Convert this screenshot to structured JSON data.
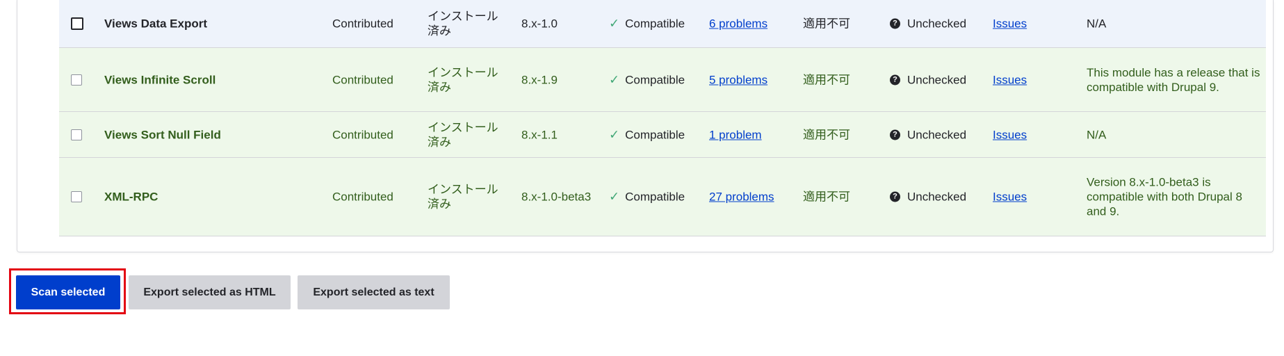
{
  "table": {
    "rows": [
      {
        "name": "Views Data Export",
        "type": "Contributed",
        "status": "インストール済み",
        "version": "8.x-1.0",
        "compatibility": "Compatible",
        "problems": "6 problems",
        "na": "適用不可",
        "unchecked": "Unchecked",
        "issues": "Issues",
        "notes": "N/A",
        "checked": true
      },
      {
        "name": "Views Infinite Scroll",
        "type": "Contributed",
        "status": "インストール済み",
        "version": "8.x-1.9",
        "compatibility": "Compatible",
        "problems": "5 problems",
        "na": "適用不可",
        "unchecked": "Unchecked",
        "issues": "Issues",
        "notes": "This module has a release that is compatible with Drupal 9.",
        "checked": false
      },
      {
        "name": "Views Sort Null Field",
        "type": "Contributed",
        "status": "インストール済み",
        "version": "8.x-1.1",
        "compatibility": "Compatible",
        "problems": "1 problem",
        "na": "適用不可",
        "unchecked": "Unchecked",
        "issues": "Issues",
        "notes": "N/A",
        "checked": false
      },
      {
        "name": "XML-RPC",
        "type": "Contributed",
        "status": "インストール済み",
        "version": "8.x-1.0-beta3",
        "compatibility": "Compatible",
        "problems": "27 problems",
        "na": "適用不可",
        "unchecked": "Unchecked",
        "issues": "Issues",
        "notes": "Version 8.x-1.0-beta3 is compatible with both Drupal 8 and 9.",
        "checked": false
      }
    ]
  },
  "actions": {
    "scan_label": "Scan selected",
    "export_html_label": "Export selected as HTML",
    "export_text_label": "Export selected as text"
  },
  "icons": {
    "compatible": "check-icon",
    "unchecked": "question-circle-icon"
  },
  "colors": {
    "primary": "#003ecc",
    "highlight_border": "#e30613",
    "compatible_row_bg": "#eef8ea",
    "selected_row_bg": "#eef3fb"
  }
}
